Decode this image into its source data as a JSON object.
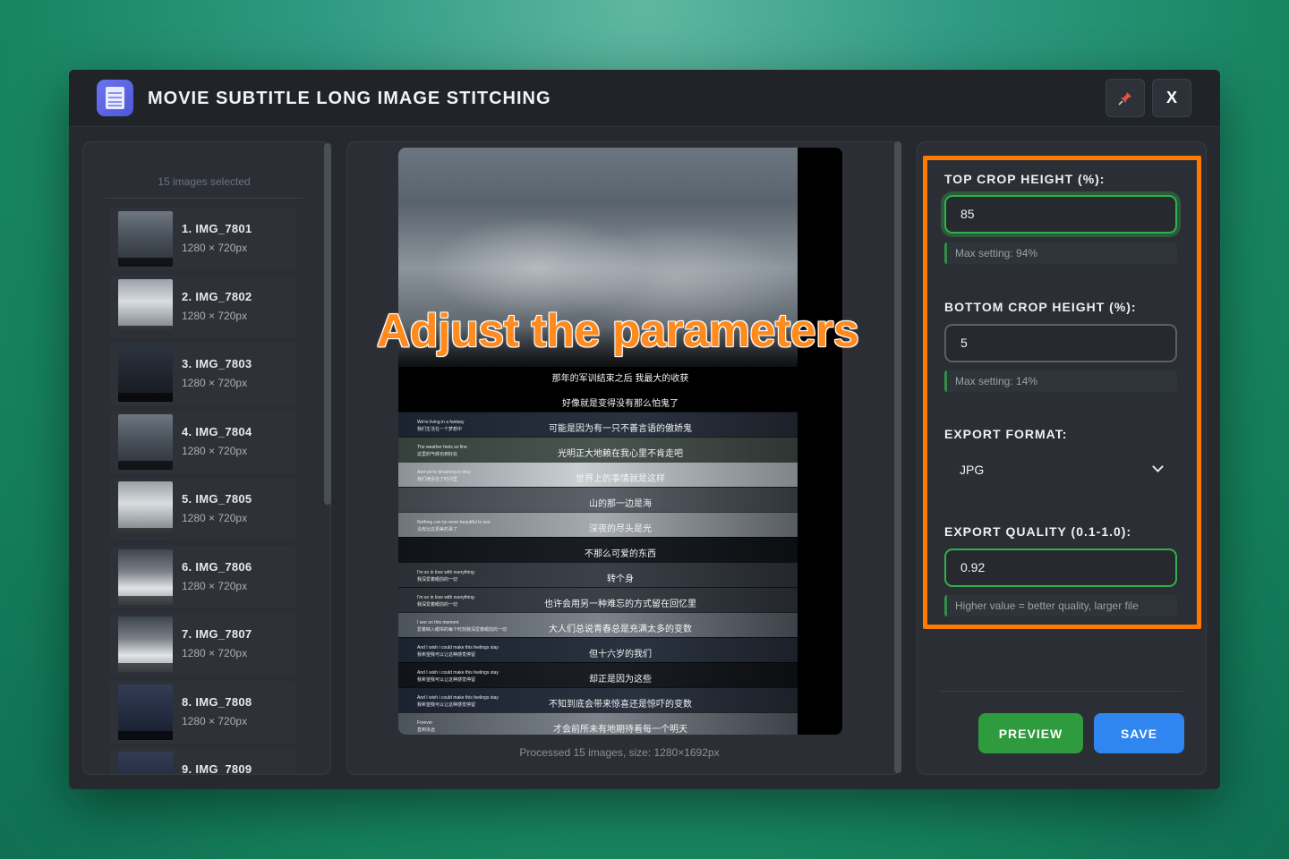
{
  "window": {
    "title": "MOVIE SUBTITLE LONG IMAGE STITCHING",
    "pin_icon": "pin-icon",
    "close_label": "X"
  },
  "sidebar": {
    "selected_count": "15 images selected",
    "items": [
      {
        "name": "1. IMG_7801",
        "size": "1280 × 720px"
      },
      {
        "name": "2. IMG_7802",
        "size": "1280 × 720px"
      },
      {
        "name": "3. IMG_7803",
        "size": "1280 × 720px"
      },
      {
        "name": "4. IMG_7804",
        "size": "1280 × 720px"
      },
      {
        "name": "5. IMG_7805",
        "size": "1280 × 720px"
      },
      {
        "name": "6. IMG_7806",
        "size": "1280 × 720px"
      },
      {
        "name": "7. IMG_7807",
        "size": "1280 × 720px"
      },
      {
        "name": "8. IMG_7808",
        "size": "1280 × 720px"
      },
      {
        "name": "9. IMG_7809",
        "size": ""
      }
    ]
  },
  "preview": {
    "overlay_text": "Adjust the parameters",
    "subtitles": [
      {
        "zh": "那年的军训结束之后 我最大的收获",
        "en": ""
      },
      {
        "zh": "好像就是变得没有那么怕鬼了",
        "en": ""
      },
      {
        "zh": "可能是因为有一只不善言语的傲娇鬼",
        "en": "We're living in a fantasy\n我们生活在一个梦想中"
      },
      {
        "zh": "光明正大地赖在我心里不肯走吧",
        "en": "The weather feels so fine\n这里的气候也到好处"
      },
      {
        "zh": "世界上的事情就是这样",
        "en": "And we're drowning in time\n我们淹没在了时间里"
      },
      {
        "zh": "山的那一边是海",
        "en": ""
      },
      {
        "zh": "深夜的尽头是光",
        "en": "Nothing can be more beautiful to see\n没有比这更美的事了"
      },
      {
        "zh": "不那么可爱的东西",
        "en": ""
      },
      {
        "zh": "转个身",
        "en": "I'm so in love with everything\n我深爱着眼前的一切"
      },
      {
        "zh": "也许会用另一种难忘的方式留在回忆里",
        "en": "I'm so in love with everything\n我深爱着眼前的一切"
      },
      {
        "zh": "大人们总说青春总是充满太多的变数",
        "en": "I see on this moment\n爱着映入眼帘的每个时刻我深爱着眼前的一切"
      },
      {
        "zh": "但十六岁的我们",
        "en": "And I wish i could make this feelings stay\n我希望我可以让这种感觉停留"
      },
      {
        "zh": "却正是因为这些",
        "en": "And I wish i could make this feelings stay\n我希望我可以让这种感觉停留"
      },
      {
        "zh": "不知到底会带来惊喜还是惊吓的变数",
        "en": "And I wish i could make this feelings stay\n我希望我可以让这种感觉停留"
      },
      {
        "zh": "才会前所未有地期待着每一个明天",
        "en": "Forever\n直到永远"
      }
    ],
    "caption": "Processed 15 images, size: 1280×1692px"
  },
  "settings": {
    "top_crop": {
      "label": "TOP CROP HEIGHT (%):",
      "value": "85",
      "hint": "Max setting: 94%"
    },
    "bottom_crop": {
      "label": "BOTTOM CROP HEIGHT (%):",
      "value": "5",
      "hint": "Max setting: 14%"
    },
    "export_format": {
      "label": "EXPORT FORMAT:",
      "value": "JPG"
    },
    "export_quality": {
      "label": "EXPORT QUALITY (0.1-1.0):",
      "value": "0.92",
      "hint": "Higher value = better quality, larger file"
    },
    "preview_label": "PREVIEW",
    "save_label": "SAVE"
  },
  "colors": {
    "accent_orange": "#ff7a00",
    "preview_button": "#2e9b3e",
    "save_button": "#2f86f0",
    "input_focus": "#2fb04a"
  }
}
